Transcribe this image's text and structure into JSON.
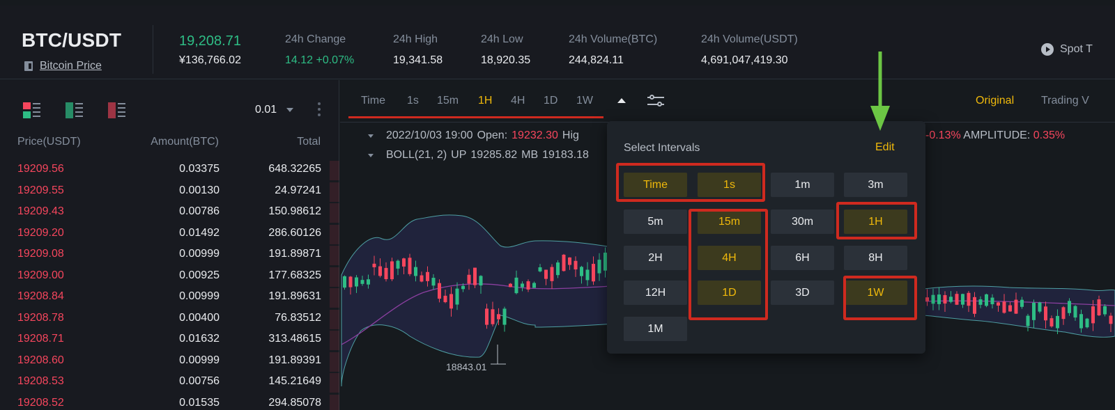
{
  "header": {
    "pair": "BTC/USDT",
    "sub_link": "Bitcoin Price",
    "last_price": "19,208.71",
    "last_price_fiat": "¥136,766.02",
    "stats": [
      {
        "label": "24h Change",
        "value": "14.12 +0.07%",
        "positive": true
      },
      {
        "label": "24h High",
        "value": "19,341.58"
      },
      {
        "label": "24h Low",
        "value": "18,920.35"
      },
      {
        "label": "24h Volume(BTC)",
        "value": "244,824.11"
      },
      {
        "label": "24h Volume(USDT)",
        "value": "4,691,047,419.30"
      }
    ],
    "spot_tutorial": "Spot T"
  },
  "orderbook": {
    "precision": "0.01",
    "columns": [
      "Price(USDT)",
      "Amount(BTC)",
      "Total"
    ],
    "rows": [
      {
        "price": "19209.56",
        "amount": "0.03375",
        "total": "648.32265"
      },
      {
        "price": "19209.55",
        "amount": "0.00130",
        "total": "24.97241"
      },
      {
        "price": "19209.43",
        "amount": "0.00786",
        "total": "150.98612"
      },
      {
        "price": "19209.20",
        "amount": "0.01492",
        "total": "286.60126"
      },
      {
        "price": "19209.08",
        "amount": "0.00999",
        "total": "191.89871"
      },
      {
        "price": "19209.00",
        "amount": "0.00925",
        "total": "177.68325"
      },
      {
        "price": "19208.84",
        "amount": "0.00999",
        "total": "191.89631"
      },
      {
        "price": "19208.78",
        "amount": "0.00400",
        "total": "76.83512"
      },
      {
        "price": "19208.71",
        "amount": "0.01632",
        "total": "313.48615"
      },
      {
        "price": "19208.60",
        "amount": "0.00999",
        "total": "191.89391"
      },
      {
        "price": "19208.53",
        "amount": "0.00756",
        "total": "145.21649"
      },
      {
        "price": "19208.52",
        "amount": "0.01535",
        "total": "294.85078"
      }
    ]
  },
  "chart": {
    "timeframes": [
      "Time",
      "1s",
      "15m",
      "1H",
      "4H",
      "1D",
      "1W"
    ],
    "active_timeframe": "1H",
    "view_original": "Original",
    "view_tradingview": "Trading V",
    "ohlc": {
      "date": "2022/10/03 19:00",
      "open_label": "Open:",
      "open_value": "19232.30",
      "high_label": "Hig",
      "change_value": "-0.13%",
      "amplitude_label": "AMPLITUDE:",
      "amplitude_value": "0.35%"
    },
    "boll": {
      "label": "BOLL(21, 2)",
      "up_label": "UP",
      "up_value": "19285.82",
      "mb_label": "MB",
      "mb_value": "19183.18"
    },
    "low_marker": "18843.01"
  },
  "interval_popup": {
    "title": "Select Intervals",
    "edit_label": "Edit",
    "intervals": [
      {
        "label": "Time",
        "selected": true
      },
      {
        "label": "1s",
        "selected": true
      },
      {
        "label": "1m",
        "selected": false
      },
      {
        "label": "3m",
        "selected": false
      },
      {
        "label": "5m",
        "selected": false
      },
      {
        "label": "15m",
        "selected": true
      },
      {
        "label": "30m",
        "selected": false
      },
      {
        "label": "1H",
        "selected": true
      },
      {
        "label": "2H",
        "selected": false
      },
      {
        "label": "4H",
        "selected": true
      },
      {
        "label": "6H",
        "selected": false
      },
      {
        "label": "8H",
        "selected": false
      },
      {
        "label": "12H",
        "selected": false
      },
      {
        "label": "1D",
        "selected": true
      },
      {
        "label": "3D",
        "selected": false
      },
      {
        "label": "1W",
        "selected": true
      },
      {
        "label": "1M",
        "selected": false
      }
    ]
  },
  "colors": {
    "up": "#2ebd85",
    "down": "#f6465d",
    "accent": "#f0b90b",
    "annotation_red": "#cf2a1f",
    "annotation_green": "#6cc644"
  }
}
